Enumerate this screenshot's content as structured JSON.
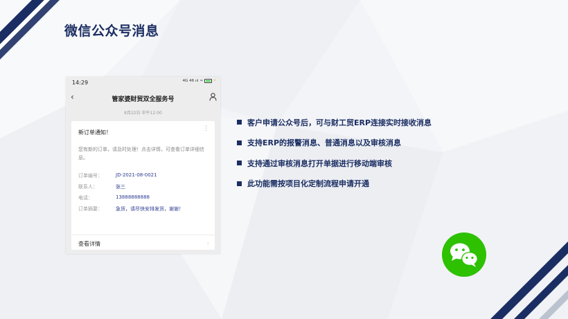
{
  "slide": {
    "title": "微信公众号消息"
  },
  "phone": {
    "status_time": "14:29",
    "status_signal": "4G 46 ııl",
    "nav_title": "管家婆财贸双全服务号",
    "date_line": "8月22日 中午12:00",
    "message": {
      "title": "新订单通知！",
      "description": "您有新的订单，请及时处理！点击详情，可查看订单详细信息。",
      "fields": [
        {
          "label": "订单编号：",
          "value": "JD-2021-08-0021"
        },
        {
          "label": "联系人：",
          "value": "张三"
        },
        {
          "label": "电话：",
          "value": "13888888888"
        },
        {
          "label": "订单摘要：",
          "value": "急货，请尽快安排发货，谢谢！"
        }
      ],
      "view_detail": "查看详情"
    }
  },
  "bullets": [
    "客户申请公众号后，可与财工贸ERP连接实时接收消息",
    "支持ERP的报警消息、普通消息以及审核消息",
    "支持通过审核消息打开单据进行移动端审核",
    "此功能需按项目化定制流程申请开通"
  ],
  "colors": {
    "navy": "#1b2e63",
    "wechat_green": "#2dc100",
    "background": "#f4f5f8"
  },
  "icons": [
    "back-arrow-icon",
    "user-icon",
    "more-icon",
    "chevron-right-icon",
    "battery-icon",
    "wechat-icon"
  ]
}
